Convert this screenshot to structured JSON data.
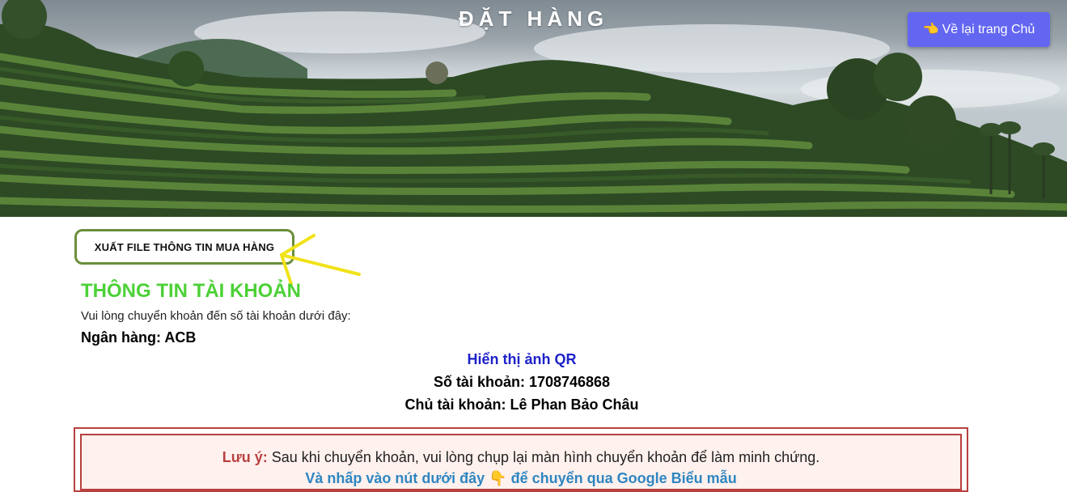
{
  "header": {
    "title": "ĐẶT HÀNG",
    "home_button": {
      "icon": "pointing-hand-icon",
      "label": "Về lại trang Chủ"
    }
  },
  "export_button": {
    "label": "XUẤT FILE THÔNG TIN MUA HÀNG"
  },
  "account": {
    "title": "THÔNG TIN TÀI KHOẢN",
    "instruction": "Vui lòng chuyển khoản đến số tài khoản dưới đây:",
    "bank": "Ngân hàng: ACB",
    "qr_link": "Hiển thị ảnh QR",
    "number": "Số tài khoản: 1708746868",
    "owner": "Chủ tài khoản: Lê Phan Bảo Châu"
  },
  "note": {
    "label": "Lưu ý:",
    "text": "Sau khi chuyển khoản, vui lòng chụp lại màn hình chuyển khoản để làm minh chứng.",
    "link_before": "Và nhấp vào nút dưới đây",
    "link_icon": "pointing-down-hand-icon",
    "link_after": "để chuyển qua Google Biểu mẫu"
  },
  "colors": {
    "accent": "#6366f1",
    "account_title": "#4cd137",
    "qr_link": "#1d22c9",
    "note_border": "#b8403e",
    "note_link": "#2e86c1",
    "export_border": "#6b8e3a"
  }
}
